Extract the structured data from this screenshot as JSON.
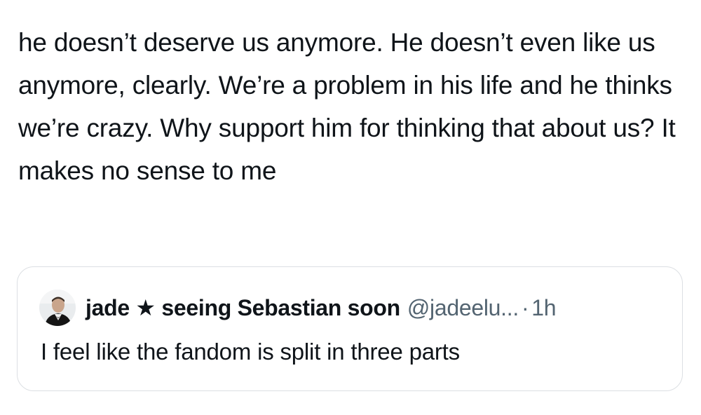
{
  "tweet": {
    "text": "he doesn’t deserve us anymore. He doesn’t even like us anymore, clearly. We’re a problem in his life and he thinks we’re crazy. Why support him for thinking that about us? It makes no sense to me"
  },
  "quote": {
    "display_name": "jade ★ seeing Sebastian soon",
    "handle": "@jadeelu...",
    "separator": "·",
    "time": "1h",
    "text": "I feel like the fandom is split in three parts"
  },
  "colors": {
    "text_primary": "#0f1419",
    "text_secondary": "#536471",
    "card_border": "#dcdfe3"
  }
}
